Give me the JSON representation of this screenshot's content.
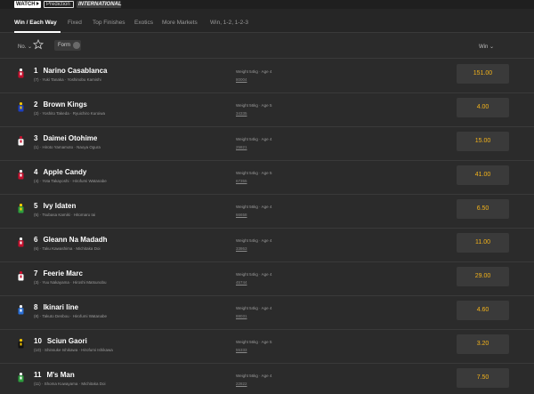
{
  "header": {
    "watch_label": "WATCH",
    "prediction_label": "Prediction",
    "international_label": "INTERNATIONAL"
  },
  "tabs": [
    {
      "label": "Win / Each Way",
      "active": true
    },
    {
      "label": "Fixed"
    },
    {
      "label": "Top Finishes"
    },
    {
      "label": "Exotics"
    },
    {
      "label": "More Markets"
    },
    {
      "label": "Win, 1-2, 1-2-3"
    }
  ],
  "filters": {
    "sort_label": "No.",
    "form_label": "Form",
    "win_label": "Win"
  },
  "colors": {
    "odds_text": "#f2b21b",
    "background": "#2b2b2b"
  },
  "runners": [
    {
      "num": "1",
      "name": "Narino Casablanca",
      "people": "(7) · Yuki Tanaka · Yoshinobu Kamishi",
      "weight": "Weight 54kg · Age 4",
      "form": "80004",
      "odds": "151.00",
      "silk": [
        "#c8102e",
        "#ffffff"
      ]
    },
    {
      "num": "2",
      "name": "Brown Kings",
      "people": "(2) · Yoshito Takeda · Ryuichiro Kuroiwa",
      "weight": "Weight 56kg · Age 5",
      "form": "34335",
      "odds": "4.00",
      "silk": [
        "#1d3fbf",
        "#f3c400"
      ]
    },
    {
      "num": "3",
      "name": "Daimei Otohime",
      "people": "(1) · Hiroto Yamamoto · Naoya Ogura",
      "weight": "Weight 54kg · Age 4",
      "form": "25821",
      "odds": "15.00",
      "silk": [
        "#ffffff",
        "#c8102e"
      ]
    },
    {
      "num": "4",
      "name": "Apple Candy",
      "people": "(4) · Yota Takayoshi · Hirofumi Watanabe",
      "weight": "Weight 54kg · Age 5",
      "form": "67355",
      "odds": "41.00",
      "silk": [
        "#c8102e",
        "#ffffff"
      ]
    },
    {
      "num": "5",
      "name": "Ivy Idaten",
      "people": "(5) · Tsubasa Kamiki · Hitomaru Iai",
      "weight": "Weight 56kg · Age 4",
      "form": "66658",
      "odds": "6.50",
      "silk": [
        "#2e9e3e",
        "#ffd200"
      ]
    },
    {
      "num": "6",
      "name": "Gleann Na Madadh",
      "people": "(6) · Taku Kawashima · Michitaka Doi",
      "weight": "Weight 54kg · Age 4",
      "form": "33863",
      "odds": "11.00",
      "silk": [
        "#c8102e",
        "#ffffff"
      ]
    },
    {
      "num": "7",
      "name": "Feerie Marc",
      "people": "(3) · Yuu Nakayama · Hiroshi Matsunobu",
      "weight": "Weight 54kg · Age 4",
      "form": "45744",
      "odds": "29.00",
      "silk": [
        "#ffffff",
        "#c8102e"
      ]
    },
    {
      "num": "8",
      "name": "Ikinari Iine",
      "people": "(8) · Takuto Denbou · Hirofumi Watanabe",
      "weight": "Weight 54kg · Age 4",
      "form": "88031",
      "odds": "4.60",
      "silk": [
        "#2a6fd6",
        "#ffffff"
      ]
    },
    {
      "num": "10",
      "name": "Sciun Gaori",
      "people": "(10) · Shinsuke Ishikawa · Hirofumi Ishikawa",
      "weight": "Weight 56kg · Age 5",
      "form": "55333",
      "odds": "3.20",
      "silk": [
        "#111111",
        "#f3c400"
      ]
    },
    {
      "num": "11",
      "name": "M's Man",
      "people": "(11) · Shoma Kuwayama · Michitaka Doi",
      "weight": "Weight 56kg · Age 4",
      "form": "22822",
      "odds": "7.50",
      "silk": [
        "#2e9e3e",
        "#ffffff"
      ]
    }
  ]
}
